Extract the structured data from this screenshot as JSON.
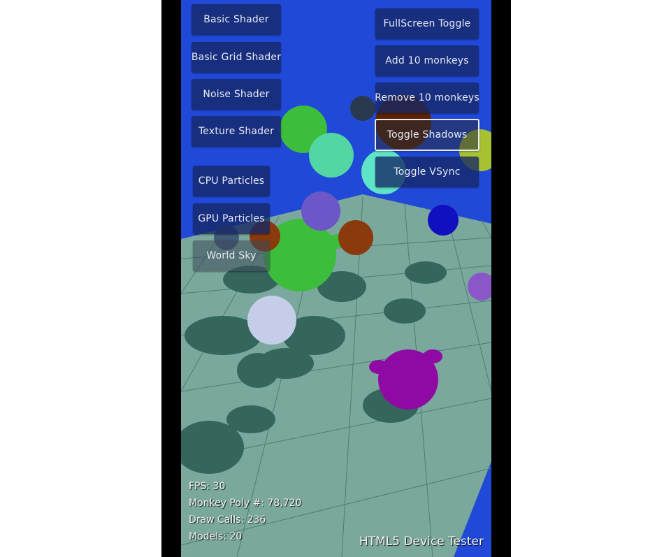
{
  "buttons_left": {
    "basic_shader": "Basic Shader",
    "basic_grid_shader": "Basic Grid Shader",
    "noise_shader": "Noise Shader",
    "texture_shader": "Texture Shader",
    "cpu_particles": "CPU Particles",
    "gpu_particles": "GPU Particles",
    "world_sky": "World Sky"
  },
  "buttons_right": {
    "fullscreen_toggle": "FullScreen Toggle",
    "add_monkeys": "Add 10 monkeys",
    "remove_monkeys": "Remove 10 monkeys",
    "toggle_shadows": "Toggle Shadows",
    "toggle_vsync": "Toggle VSync"
  },
  "stats": {
    "fps": "FPS: 30",
    "monkey_poly": "Monkey Poly #: 78,720",
    "draw_calls": "Draw Calls: 236",
    "models": "Models: 20"
  },
  "brand": "HTML5 Device Tester",
  "colors": {
    "sky": "#2149d8",
    "floor": "#7aa89c",
    "shadow": "#35665c",
    "button_bg": "#162764"
  }
}
